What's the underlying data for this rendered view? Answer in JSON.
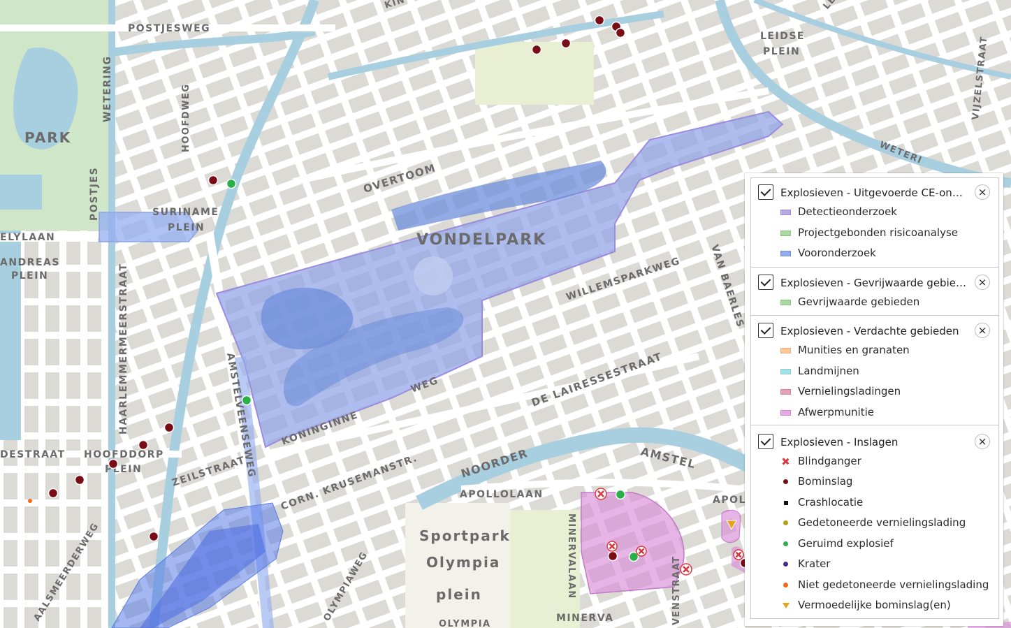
{
  "map_labels": {
    "postjesweg": "POSTJESWEG",
    "park": "PARK",
    "wetering": "WETERING",
    "hoofdweg": "HOOFDWEG",
    "postjes": "POSTJES",
    "suriname_plein": [
      "SURINAME",
      "PLEIN"
    ],
    "elylaan": "ELYLAAN",
    "andreas_plein": [
      "ANDREAS",
      "PLEIN"
    ],
    "haarlemmermeerstraat": "HAARLEMMERMEERSTRAAT",
    "destraat": "DESTRAAT",
    "hoofddorp_plein": [
      "HOOFDDORP",
      "PLEIN"
    ],
    "aalsmeerderweg": "AALSMEERDERWEG",
    "zeilstraat": "ZEILSTRAAT",
    "amstelveenseweg": "AMSTELVEENSEWEG",
    "overtoom": "OVERTOOM",
    "vondelpark": "VONDELPARK",
    "willemsparkweg": "WILLEMSPARKWEG",
    "van_baerle": "VAN BAERLES",
    "de_lairessestraat": "DE LAIRESSESTRAAT",
    "koninginneweg": [
      "KONINGINNE",
      "WEG"
    ],
    "corn_krusemanstr": "CORN. KRUSEMANSTR.",
    "noorder": "NOORDER",
    "amstel": "AMSTEL",
    "apollolaan": "APOLLOLAAN",
    "apol": "APOL",
    "sportpark_olympia": [
      "Sportpark",
      "Olympia",
      "plein"
    ],
    "olympiaweg": "OLYMPIAWEG",
    "minervalaan": "MINERVALAAN",
    "minerva": "MINERVA",
    "olympia": "OLYMPIA",
    "vensstraat": "VENSTRAAT",
    "leidse_plein": [
      "LEIDSE",
      "PLEIN"
    ],
    "vijzelstraat": "VIJZELSTRAAT",
    "weteri": "WETERI",
    "kin": "KIN",
    "le": "LE"
  },
  "legend": {
    "groups": [
      {
        "title": "Explosieven - Uitgevoerde CE-onderzoeken",
        "checked": true,
        "items": [
          {
            "label": "Detectieonderzoek",
            "color": "#b5a9e0"
          },
          {
            "label": "Projectgebonden risicoanalyse",
            "color": "#a8d8a0"
          },
          {
            "label": "Vooronderzoek",
            "color": "#93aef0"
          }
        ]
      },
      {
        "title": "Explosieven - Gevrijwaarde gebieden",
        "checked": true,
        "items": [
          {
            "label": "Gevrijwaarde gebieden",
            "color": "#a8d8a0"
          }
        ]
      },
      {
        "title": "Explosieven - Verdachte gebieden",
        "checked": true,
        "items": [
          {
            "label": "Munities en granaten",
            "color": "#f8c99a"
          },
          {
            "label": "Landmijnen",
            "color": "#a6e1e8"
          },
          {
            "label": "Vernielingsladingen",
            "color": "#e6a0b4"
          },
          {
            "label": "Afwerpmunitie",
            "color": "#e6a8e6"
          }
        ]
      },
      {
        "title": "Explosieven - Inslagen",
        "checked": true,
        "items": [
          {
            "label": "Blindganger",
            "icon": "x-marker-icon",
            "color": "#d9363e"
          },
          {
            "label": "Bominslag",
            "icon": "dot-icon",
            "color": "#7a0c16"
          },
          {
            "label": "Crashlocatie",
            "icon": "square-icon",
            "color": "#111111"
          },
          {
            "label": "Gedetoneerde vernielingslading",
            "icon": "dot-icon",
            "color": "#b5a316"
          },
          {
            "label": "Geruimd explosief",
            "icon": "dot-icon",
            "color": "#2ab04a"
          },
          {
            "label": "Krater",
            "icon": "dot-icon",
            "color": "#4b2a8c"
          },
          {
            "label": "Niet gedetoneerde vernielingslading",
            "icon": "dot-icon",
            "color": "#f26a1b"
          },
          {
            "label": "Vermoedelijke bominslag(en)",
            "icon": "triangle-icon",
            "color": "#e8a11a"
          }
        ]
      }
    ],
    "close_symbol": "×"
  }
}
